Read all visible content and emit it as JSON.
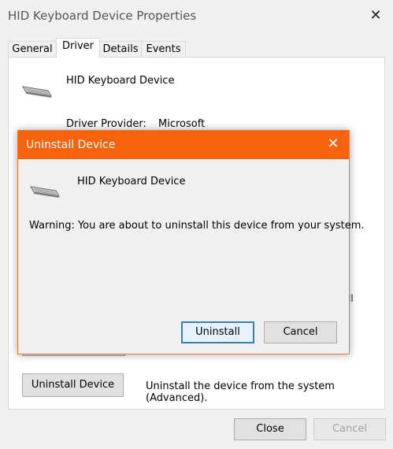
{
  "window": {
    "title": "HID Keyboard Device Properties",
    "close_glyph": "✕"
  },
  "tabs": [
    {
      "label": "General",
      "active": false
    },
    {
      "label": "Driver",
      "active": true
    },
    {
      "label": "Details",
      "active": false
    },
    {
      "label": "Events",
      "active": false
    }
  ],
  "panel": {
    "device_name": "HID Keyboard Device",
    "icon": "keyboard-icon",
    "provider_label": "Driver Provider:",
    "provider_value": "Microsoft",
    "uninstall_button": "Uninstall Device",
    "uninstall_description": "Uninstall the device from the system (Advanced)."
  },
  "footer": {
    "close_label": "Close",
    "cancel_label": "Cancel"
  },
  "dialog": {
    "title": "Uninstall Device",
    "close_glyph": "✕",
    "device_name": "HID Keyboard Device",
    "icon": "keyboard-icon",
    "warning": "Warning: You are about to uninstall this device from your system.",
    "uninstall_label": "Uninstall",
    "cancel_label": "Cancel",
    "accent_color": "#f7630c"
  }
}
